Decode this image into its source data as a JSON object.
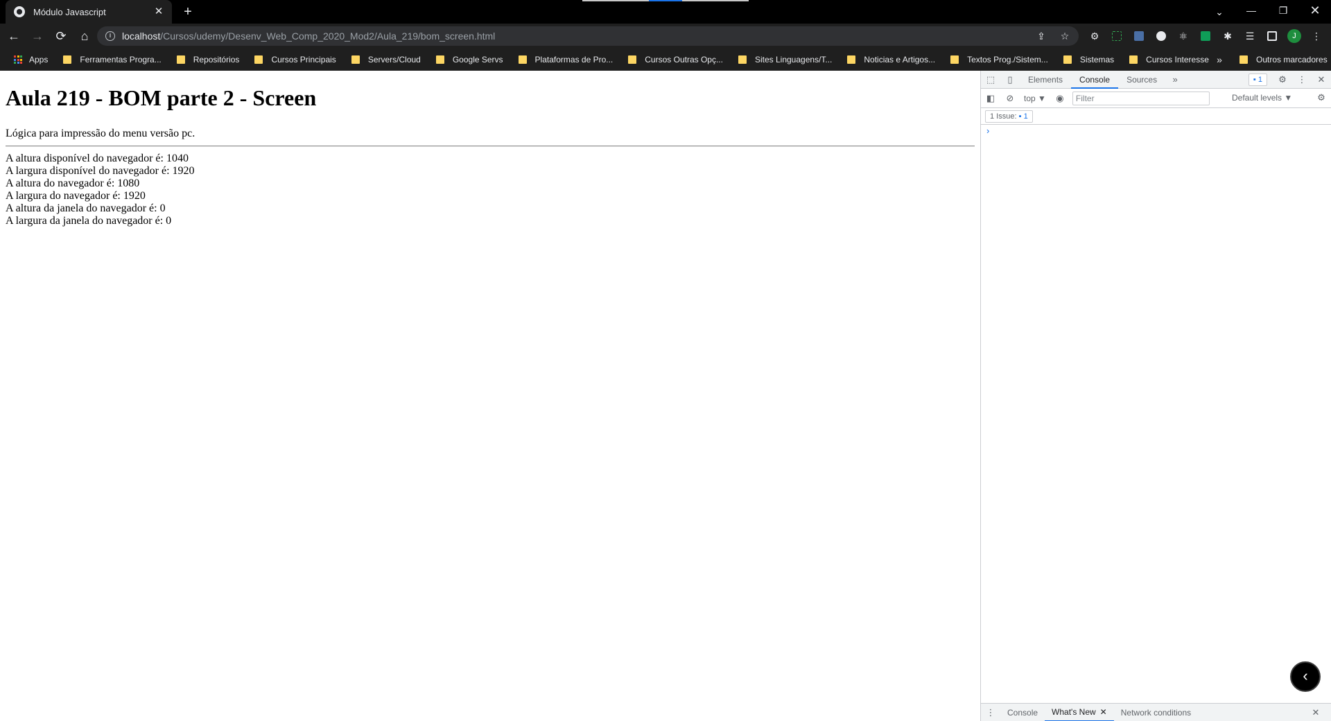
{
  "browser": {
    "tab_title": "Módulo Javascript",
    "tab_close": "✕",
    "new_tab": "+",
    "url_host": "localhost",
    "url_path": "/Cursos/udemy/Desenv_Web_Comp_2020_Mod2/Aula_219/bom_screen.html",
    "profile_initial": "J",
    "nav": {
      "back": "←",
      "forward": "→",
      "reload": "⟳",
      "home": "⌂"
    },
    "window_controls": {
      "tab_search": "⌄",
      "minimize": "—",
      "restore": "❐",
      "close": "✕"
    }
  },
  "bookmarks": {
    "apps": "Apps",
    "items": [
      "Ferramentas Progra...",
      "Repositórios",
      "Cursos Principais",
      "Servers/Cloud",
      "Google Servs",
      "Plataformas de Pro...",
      "Cursos Outras Opç...",
      "Sites Linguagens/T...",
      "Noticias e Artigos...",
      "Textos Prog./Sistem...",
      "Sistemas",
      "Cursos Interesse"
    ],
    "more": "»",
    "other": "Outros marcadores",
    "folder_color": "#fdd663"
  },
  "page": {
    "title": "Aula 219 - BOM parte 2 - Screen",
    "subtitle": "Lógica para impressão do menu versão pc.",
    "lines": [
      "A altura disponível do navegador é: 1040",
      "A largura disponível do navegador é: 1920",
      "A altura do navegador é: 1080",
      "A largura do navegador é: 1920",
      "A altura da janela do navegador é: 0",
      "A largura da janela do navegador é: 0"
    ]
  },
  "devtools": {
    "tabs": [
      "Elements",
      "Console",
      "Sources"
    ],
    "active_tab": "Console",
    "more_tabs": "»",
    "message_badge": "1",
    "context": "top ▼",
    "filter_placeholder": "Filter",
    "levels": "Default levels ▼",
    "issues_label": "1 Issue:",
    "issues_count": "1",
    "prompt": "›",
    "drawer_tabs": [
      "Console",
      "What's New",
      "Network conditions"
    ],
    "drawer_active": "What's New",
    "drawer_close": "✕",
    "accent": "#1a73e8"
  }
}
